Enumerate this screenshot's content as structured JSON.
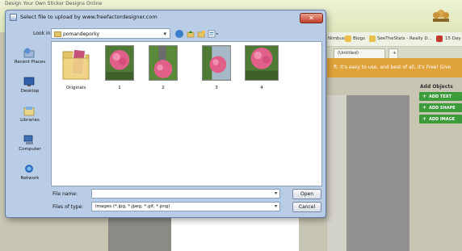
{
  "background": {
    "page_title": "Design Your Own Sticker Designs Online",
    "bookmarks": [
      "Nimbus",
      "Blogs",
      "SeeTheStats - Really D...",
      "15 Day"
    ],
    "tabs": [
      "(Untitled)"
    ],
    "banner": "ft. It's easy to use, and best of all, it's Free! Give",
    "add_objects": "Add Objects",
    "add_buttons": [
      "ADD TEXT",
      "ADD SHAPE",
      "ADD IMAGE"
    ]
  },
  "dialog": {
    "title": "Select file to upload by www.freefactordesigner.com",
    "close_label": "✕",
    "look_in_label": "Look in:",
    "look_in_value": "pomandeporky",
    "places": [
      {
        "label": "Recent Places",
        "icon": "recent-places-icon"
      },
      {
        "label": "Desktop",
        "icon": "desktop-icon"
      },
      {
        "label": "Libraries",
        "icon": "libraries-icon"
      },
      {
        "label": "Computer",
        "icon": "computer-icon"
      },
      {
        "label": "Network",
        "icon": "network-icon"
      }
    ],
    "files": [
      {
        "label": "Originals",
        "type": "folder"
      },
      {
        "label": "1",
        "type": "image"
      },
      {
        "label": "2",
        "type": "image"
      },
      {
        "label": "3",
        "type": "image"
      },
      {
        "label": "4",
        "type": "image"
      }
    ],
    "file_name_label": "File name:",
    "file_name_value": "",
    "file_type_label": "Files of type:",
    "file_type_value": "Images (*.jpg, *.jpeg, *.gif, *.png)",
    "open_label": "Open",
    "cancel_label": "Cancel"
  },
  "colors": {
    "dialog_frame": "#b9cde6",
    "close_red": "#c2402a",
    "add_button_green": "#3c9c3c",
    "banner_orange": "#e0a23a"
  }
}
